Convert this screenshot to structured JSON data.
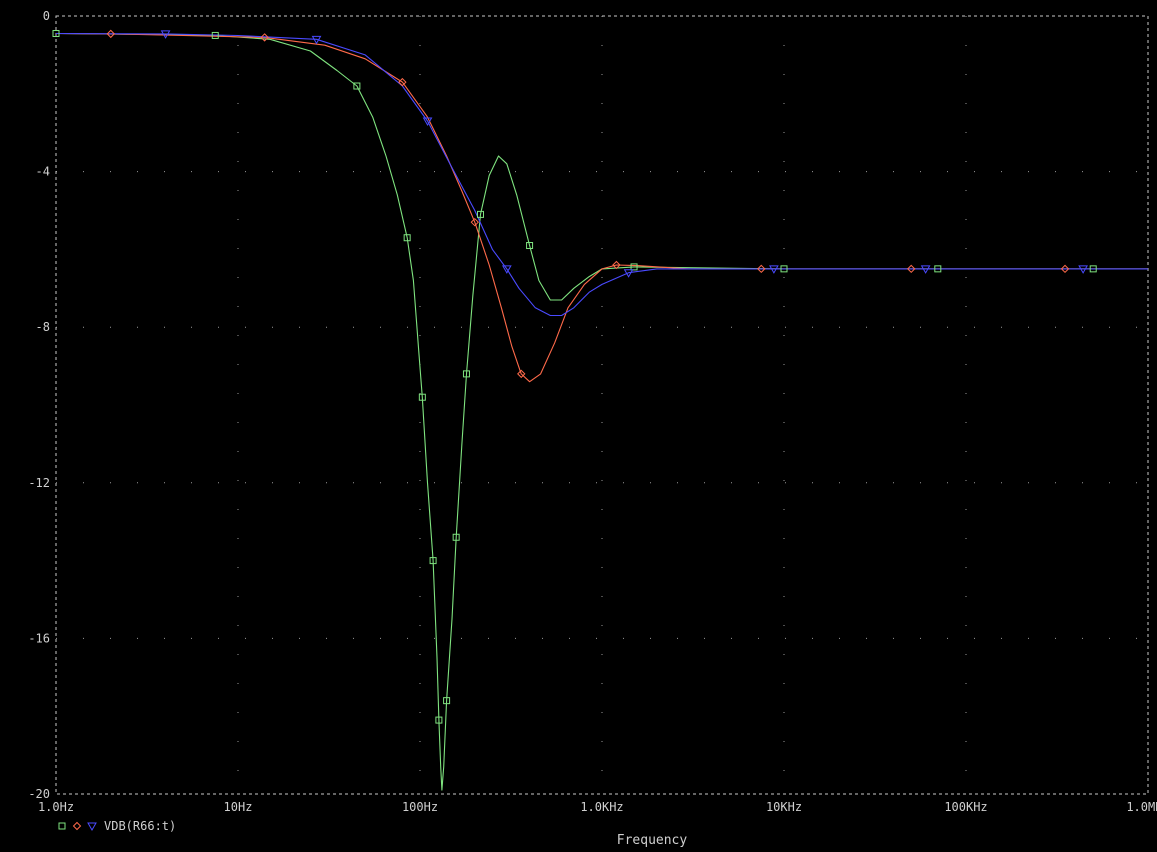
{
  "chart_data": {
    "type": "line",
    "xscale": "log",
    "xlim": [
      1,
      1000000
    ],
    "ylim": [
      -20,
      0
    ],
    "x_ticks": [
      {
        "value": 1,
        "label": "1.0Hz"
      },
      {
        "value": 10,
        "label": "10Hz"
      },
      {
        "value": 100,
        "label": "100Hz"
      },
      {
        "value": 1000,
        "label": "1.0KHz"
      },
      {
        "value": 10000,
        "label": "10KHz"
      },
      {
        "value": 100000,
        "label": "100KHz"
      },
      {
        "value": 1000000,
        "label": "1.0MHz"
      }
    ],
    "y_ticks": [
      {
        "value": 0,
        "label": "0"
      },
      {
        "value": -4,
        "label": "-4"
      },
      {
        "value": -8,
        "label": "-8"
      },
      {
        "value": -12,
        "label": "-12"
      },
      {
        "value": -16,
        "label": "-16"
      },
      {
        "value": -20,
        "label": "-20"
      }
    ],
    "xlabel": "Frequency",
    "ylabel": "",
    "grid": "dotted",
    "legend": {
      "placement": "bottom-left",
      "text": "VDB(R66:t)"
    },
    "series": [
      {
        "color": "#7fe37f",
        "marker": "square",
        "points": [
          [
            1,
            -0.45
          ],
          [
            3,
            -0.47
          ],
          [
            7.5,
            -0.5
          ],
          [
            15,
            -0.6
          ],
          [
            25,
            -0.9
          ],
          [
            35,
            -1.4
          ],
          [
            45,
            -1.8
          ],
          [
            55,
            -2.6
          ],
          [
            65,
            -3.6
          ],
          [
            75,
            -4.6
          ],
          [
            85,
            -5.7
          ],
          [
            92,
            -6.8
          ],
          [
            98,
            -8.5
          ],
          [
            103,
            -9.8
          ],
          [
            110,
            -12.0
          ],
          [
            118,
            -14.0
          ],
          [
            124,
            -16.5
          ],
          [
            127,
            -18.1
          ],
          [
            130,
            -19.3
          ],
          [
            132,
            -19.9
          ],
          [
            135,
            -19.3
          ],
          [
            140,
            -17.6
          ],
          [
            150,
            -15.5
          ],
          [
            158,
            -13.4
          ],
          [
            170,
            -11.0
          ],
          [
            180,
            -9.2
          ],
          [
            195,
            -7.2
          ],
          [
            215,
            -5.1
          ],
          [
            240,
            -4.1
          ],
          [
            270,
            -3.6
          ],
          [
            300,
            -3.8
          ],
          [
            340,
            -4.6
          ],
          [
            400,
            -5.9
          ],
          [
            450,
            -6.8
          ],
          [
            520,
            -7.3
          ],
          [
            600,
            -7.3
          ],
          [
            700,
            -7.0
          ],
          [
            850,
            -6.7
          ],
          [
            1000,
            -6.5
          ],
          [
            1500,
            -6.45
          ],
          [
            3000,
            -6.47
          ],
          [
            10000,
            -6.5
          ],
          [
            70000,
            -6.5
          ],
          [
            500000,
            -6.5
          ],
          [
            1000000,
            -6.5
          ]
        ],
        "markers_x": [
          1,
          7.5,
          45,
          85,
          103,
          118,
          127,
          140,
          158,
          180,
          215,
          400,
          1500,
          10000,
          70000,
          500000
        ]
      },
      {
        "color": "#ff6a4a",
        "marker": "diamond",
        "points": [
          [
            1,
            -0.45
          ],
          [
            2,
            -0.46
          ],
          [
            5,
            -0.5
          ],
          [
            14,
            -0.55
          ],
          [
            30,
            -0.75
          ],
          [
            50,
            -1.1
          ],
          [
            80,
            -1.7
          ],
          [
            110,
            -2.6
          ],
          [
            140,
            -3.6
          ],
          [
            170,
            -4.5
          ],
          [
            200,
            -5.3
          ],
          [
            240,
            -6.4
          ],
          [
            280,
            -7.5
          ],
          [
            320,
            -8.5
          ],
          [
            360,
            -9.2
          ],
          [
            400,
            -9.4
          ],
          [
            460,
            -9.2
          ],
          [
            550,
            -8.4
          ],
          [
            650,
            -7.5
          ],
          [
            800,
            -6.9
          ],
          [
            1000,
            -6.5
          ],
          [
            1200,
            -6.4
          ],
          [
            1600,
            -6.42
          ],
          [
            3000,
            -6.5
          ],
          [
            7500,
            -6.5
          ],
          [
            50000,
            -6.5
          ],
          [
            350000,
            -6.5
          ],
          [
            1000000,
            -6.5
          ]
        ],
        "markers_x": [
          2,
          14,
          80,
          200,
          360,
          1200,
          7500,
          50000,
          350000
        ]
      },
      {
        "color": "#4a4aff",
        "marker": "triangle",
        "points": [
          [
            1,
            -0.45
          ],
          [
            4,
            -0.46
          ],
          [
            10,
            -0.5
          ],
          [
            27,
            -0.6
          ],
          [
            50,
            -1.0
          ],
          [
            80,
            -1.8
          ],
          [
            110,
            -2.7
          ],
          [
            150,
            -3.9
          ],
          [
            200,
            -5.0
          ],
          [
            250,
            -6.0
          ],
          [
            300,
            -6.5
          ],
          [
            350,
            -7.0
          ],
          [
            430,
            -7.5
          ],
          [
            520,
            -7.7
          ],
          [
            600,
            -7.7
          ],
          [
            700,
            -7.5
          ],
          [
            850,
            -7.1
          ],
          [
            1000,
            -6.9
          ],
          [
            1400,
            -6.6
          ],
          [
            2000,
            -6.5
          ],
          [
            3000,
            -6.5
          ],
          [
            8800,
            -6.5
          ],
          [
            60000,
            -6.5
          ],
          [
            440000,
            -6.5
          ],
          [
            1000000,
            -6.5
          ]
        ],
        "markers_x": [
          4,
          27,
          110,
          300,
          1400,
          8800,
          60000,
          440000
        ]
      }
    ]
  }
}
